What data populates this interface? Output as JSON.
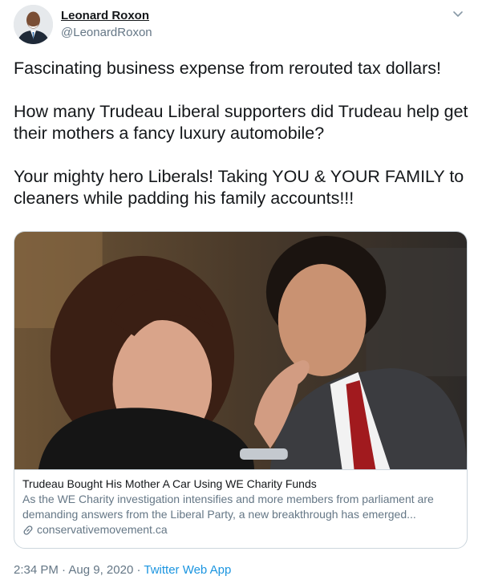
{
  "author": {
    "name": "Leonard Roxon",
    "handle": "@LeonardRoxon"
  },
  "tweet": {
    "text": "Fascinating business expense from rerouted tax dollars!\n\nHow many Trudeau Liberal supporters did Trudeau help get their mothers a fancy luxury automobile?\n\nYour mighty hero Liberals! Taking YOU & YOUR FAMILY to cleaners while padding his family accounts!!!"
  },
  "card": {
    "title": "Trudeau Bought His Mother A Car Using WE Charity Funds",
    "description": "As the WE Charity investigation intensifies and more members from parliament are demanding answers from the Liberal Party, a new breakthrough has emerged...",
    "domain": "conservativemovement.ca"
  },
  "meta": {
    "time": "2:34 PM",
    "separator1": " · ",
    "date": "Aug 9, 2020",
    "separator2": " · ",
    "app": "Twitter Web App"
  },
  "colors": {
    "text": "#14171a",
    "secondary": "#657786",
    "link": "#1b95e0",
    "border": "#ccd6dd"
  },
  "icons": {
    "menu": "chevron-down-icon",
    "link": "link-icon"
  }
}
